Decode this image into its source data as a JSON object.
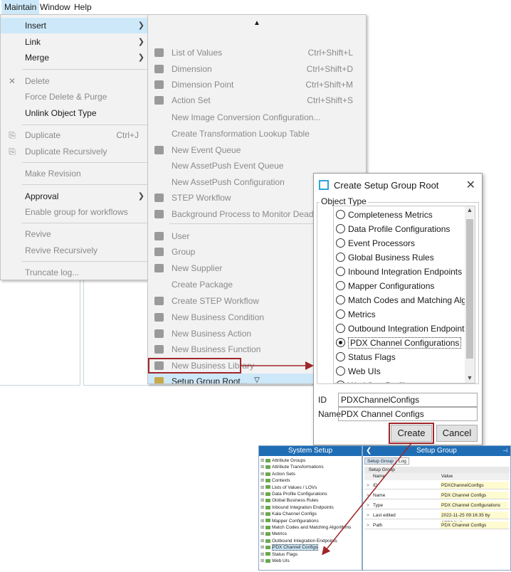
{
  "menubar": {
    "items": [
      "Maintain",
      "Window",
      "Help"
    ]
  },
  "main_menu": {
    "insert": "Insert",
    "link": "Link",
    "merge": "Merge",
    "delete": "Delete",
    "force_delete": "Force Delete & Purge",
    "unlink": "Unlink Object Type",
    "duplicate": "Duplicate",
    "duplicate_shortcut": "Ctrl+J",
    "duplicate_recursively": "Duplicate Recursively",
    "make_revision": "Make Revision",
    "approval": "Approval",
    "enable_group": "Enable group for workflows",
    "revive": "Revive",
    "revive_recursively": "Revive Recursively",
    "truncate_log": "Truncate log..."
  },
  "submenu": {
    "items": [
      {
        "label": "List of Values",
        "shortcut": "Ctrl+Shift+L",
        "icon": "list-icon"
      },
      {
        "label": "Dimension",
        "shortcut": "Ctrl+Shift+D",
        "icon": "dimension-icon"
      },
      {
        "label": "Dimension Point",
        "shortcut": "Ctrl+Shift+M",
        "icon": "dimension-point-icon"
      },
      {
        "label": "Action Set",
        "shortcut": "Ctrl+Shift+S",
        "icon": "action-set-icon"
      },
      {
        "label": "New Image Conversion Configuration...",
        "shortcut": "",
        "icon": ""
      },
      {
        "label": "Create Transformation Lookup Table",
        "shortcut": "",
        "icon": ""
      },
      {
        "label": "New Event Queue",
        "shortcut": "",
        "icon": "event-queue-icon"
      },
      {
        "label": "New AssetPush Event Queue",
        "shortcut": "",
        "icon": ""
      },
      {
        "label": "New AssetPush Configuration",
        "shortcut": "",
        "icon": ""
      },
      {
        "label": "STEP Workflow",
        "shortcut": "",
        "icon": "workflow-icon"
      },
      {
        "label": "Background Process to Monitor Deadlines",
        "shortcut": "",
        "icon": "background-process-icon"
      },
      {
        "label": "User",
        "shortcut": "",
        "icon": "user-icon"
      },
      {
        "label": "Group",
        "shortcut": "",
        "icon": "group-icon"
      },
      {
        "label": "New Supplier",
        "shortcut": "",
        "icon": "supplier-icon"
      },
      {
        "label": "Create Package",
        "shortcut": "",
        "icon": ""
      },
      {
        "label": "Create STEP Workflow",
        "shortcut": "",
        "icon": "create-workflow-icon"
      },
      {
        "label": "New Business Condition",
        "shortcut": "",
        "icon": "business-condition-icon"
      },
      {
        "label": "New Business Action",
        "shortcut": "",
        "icon": "business-action-icon"
      },
      {
        "label": "New Business Function",
        "shortcut": "",
        "icon": "business-function-icon"
      },
      {
        "label": "New Business Library",
        "shortcut": "",
        "icon": "business-library-icon"
      },
      {
        "label": "Setup Group Root...",
        "shortcut": "",
        "icon": "setup-group-root-icon"
      }
    ]
  },
  "dialog": {
    "title": "Create Setup Group Root",
    "object_type_label": "Object Type",
    "options": [
      "Completeness Metrics",
      "Data Profile Configurations",
      "Event Processors",
      "Global Business Rules",
      "Inbound Integration Endpoints",
      "Mapper Configurations",
      "Match Codes and Matching Algorithms",
      "Metrics",
      "Outbound Integration Endpoints",
      "PDX Channel Configurations",
      "Status Flags",
      "Web UIs",
      "Workflow Profiles"
    ],
    "selected_option": "PDX Channel Configurations",
    "id_label": "ID",
    "id_value": "PDXChannelConfigs",
    "name_label": "Name",
    "name_value": "PDX Channel Configs",
    "create_label": "Create",
    "cancel_label": "Cancel"
  },
  "system_setup": {
    "title": "System Setup",
    "items": [
      "Attribute Groups",
      "Attribute Transformations",
      "Action Sets",
      "Contexts",
      "Lists of Values / LOVs",
      "Data Profile Configurations",
      "Global Business Rules",
      "Inbound Integration Endpoints",
      "Kala Channel Configs",
      "Mapper Configurations",
      "Match Codes and Matching Algorithms",
      "Metrics",
      "Outbound Integration Endpoints",
      "PDX Channel Configs",
      "Status Flags",
      "Web UIs"
    ],
    "selected": "PDX Channel Configs"
  },
  "setup_group": {
    "title": "Setup Group",
    "tabs": [
      "Setup Group",
      "Log"
    ],
    "section": "Setup Group",
    "header_name": "Name",
    "header_value": "Value",
    "rows": [
      {
        "name": "ID",
        "value": "PDXChannelConfigs"
      },
      {
        "name": "Name",
        "value": "PDX Channel Configs"
      },
      {
        "name": "Type",
        "value": "PDX Channel Configurations"
      },
      {
        "name": "Last edited",
        "value": "2022-11-25 09:16:35 by STEPSYS"
      },
      {
        "name": "Path",
        "value": "PDX Channel Configs"
      }
    ]
  },
  "colors": {
    "highlight": "#cde8f9",
    "annotation_red": "#a0262a",
    "panel_header": "#1e6db5"
  }
}
